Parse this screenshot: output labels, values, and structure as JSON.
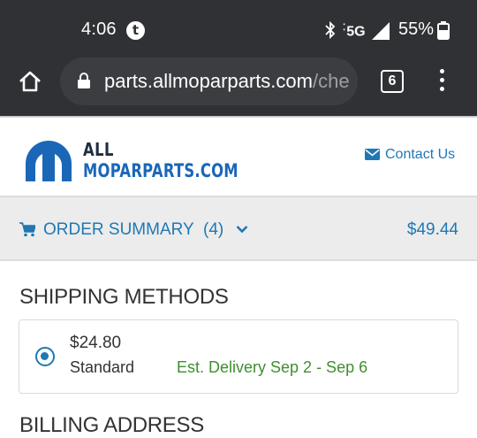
{
  "status_bar": {
    "time": "4:06",
    "network": "5G",
    "battery": "55%",
    "icons": [
      "tumblr-icon",
      "bluetooth-icon",
      "signal-icon",
      "battery-icon"
    ]
  },
  "browser": {
    "url_host": "parts.allmoparparts.com",
    "url_path": "/che",
    "tab_count": "6"
  },
  "header": {
    "logo_line1": "ALL",
    "logo_line2": "MOPARPARTS.COM",
    "contact_label": "Contact Us"
  },
  "order_summary": {
    "label": "ORDER SUMMARY",
    "count": "(4)",
    "total": "$49.44"
  },
  "shipping": {
    "title": "SHIPPING METHODS",
    "option": {
      "price": "$24.80",
      "name": "Standard",
      "estimate": "Est. Delivery Sep 2 - Sep 6",
      "selected": true
    }
  },
  "billing": {
    "title": "BILLING ADDRESS"
  },
  "colors": {
    "browser_chrome": "#303134",
    "link_blue": "#1f78b4",
    "delivery_green": "#3f8f2f",
    "logo_blue": "#1a67b8"
  }
}
